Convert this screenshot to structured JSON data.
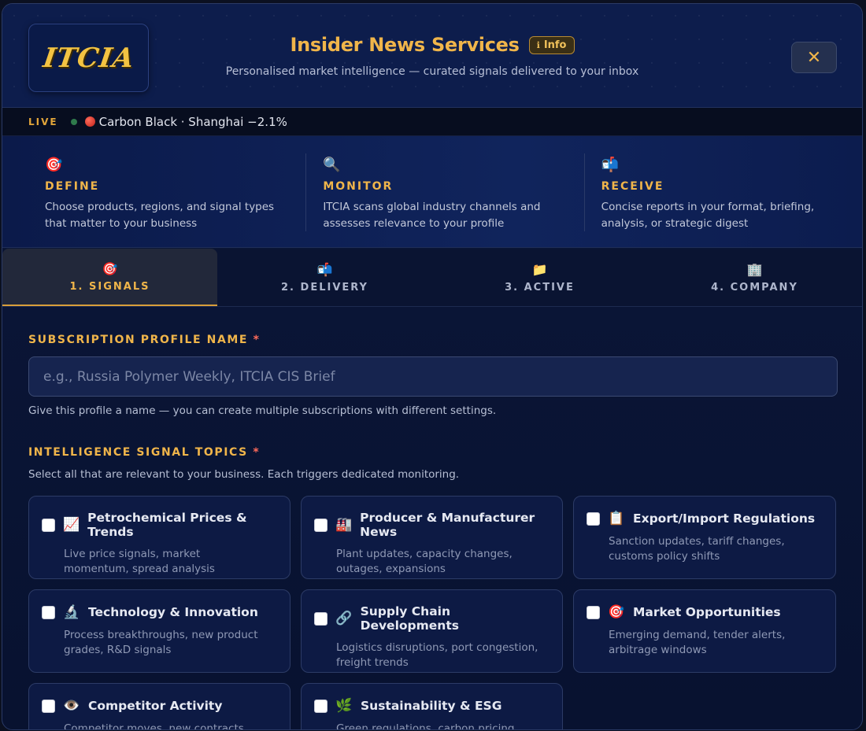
{
  "header": {
    "logo_text": "ITCIA",
    "title": "Insider News Services",
    "info_icon": "info-icon",
    "info_label": "Info",
    "subtitle": "Personalised market intelligence — curated signals delivered to your inbox",
    "close_glyph": "✕"
  },
  "ticker": {
    "live_label": "LIVE",
    "item": "Carbon Black · Shanghai −2.1%"
  },
  "steps": [
    {
      "icon": "🎯",
      "title": "DEFINE",
      "desc": "Choose products, regions, and signal types that matter to your business"
    },
    {
      "icon": "🔍",
      "title": "MONITOR",
      "desc": "ITCIA scans global industry channels and assesses relevance to your profile"
    },
    {
      "icon": "📬",
      "title": "RECEIVE",
      "desc": "Concise reports in your format, briefing, analysis, or strategic digest"
    }
  ],
  "tabs": [
    {
      "icon": "🎯",
      "label": "1. SIGNALS",
      "active": true
    },
    {
      "icon": "📬",
      "label": "2. DELIVERY",
      "active": false
    },
    {
      "icon": "📁",
      "label": "3. ACTIVE",
      "active": false
    },
    {
      "icon": "🏢",
      "label": "4. COMPANY",
      "active": false
    }
  ],
  "form": {
    "profile_label": "SUBSCRIPTION PROFILE NAME",
    "required_mark": "*",
    "profile_placeholder": "e.g., Russia Polymer Weekly, ITCIA CIS Brief",
    "profile_value": "",
    "profile_help": "Give this profile a name — you can create multiple subscriptions with different settings.",
    "topics_label": "INTELLIGENCE SIGNAL TOPICS",
    "topics_help": "Select all that are relevant to your business. Each triggers dedicated monitoring."
  },
  "topics": [
    {
      "icon": "📈",
      "title": "Petrochemical Prices & Trends",
      "desc": "Live price signals, market momentum, spread analysis",
      "checked": false
    },
    {
      "icon": "🏭",
      "title": "Producer & Manufacturer News",
      "desc": "Plant updates, capacity changes, outages, expansions",
      "checked": false
    },
    {
      "icon": "📋",
      "title": "Export/Import Regulations",
      "desc": "Sanction updates, tariff changes, customs policy shifts",
      "checked": false
    },
    {
      "icon": "🔬",
      "title": "Technology & Innovation",
      "desc": "Process breakthroughs, new product grades, R&D signals",
      "checked": false
    },
    {
      "icon": "🔗",
      "title": "Supply Chain Developments",
      "desc": "Logistics disruptions, port congestion, freight trends",
      "checked": false
    },
    {
      "icon": "🎯",
      "title": "Market Opportunities",
      "desc": "Emerging demand, tender alerts, arbitrage windows",
      "checked": false
    },
    {
      "icon": "👁️",
      "title": "Competitor Activity",
      "desc": "Competitor moves, new contracts",
      "checked": false
    },
    {
      "icon": "🌿",
      "title": "Sustainability & ESG",
      "desc": "Green regulations, carbon pricing, ESG",
      "checked": false
    }
  ]
}
